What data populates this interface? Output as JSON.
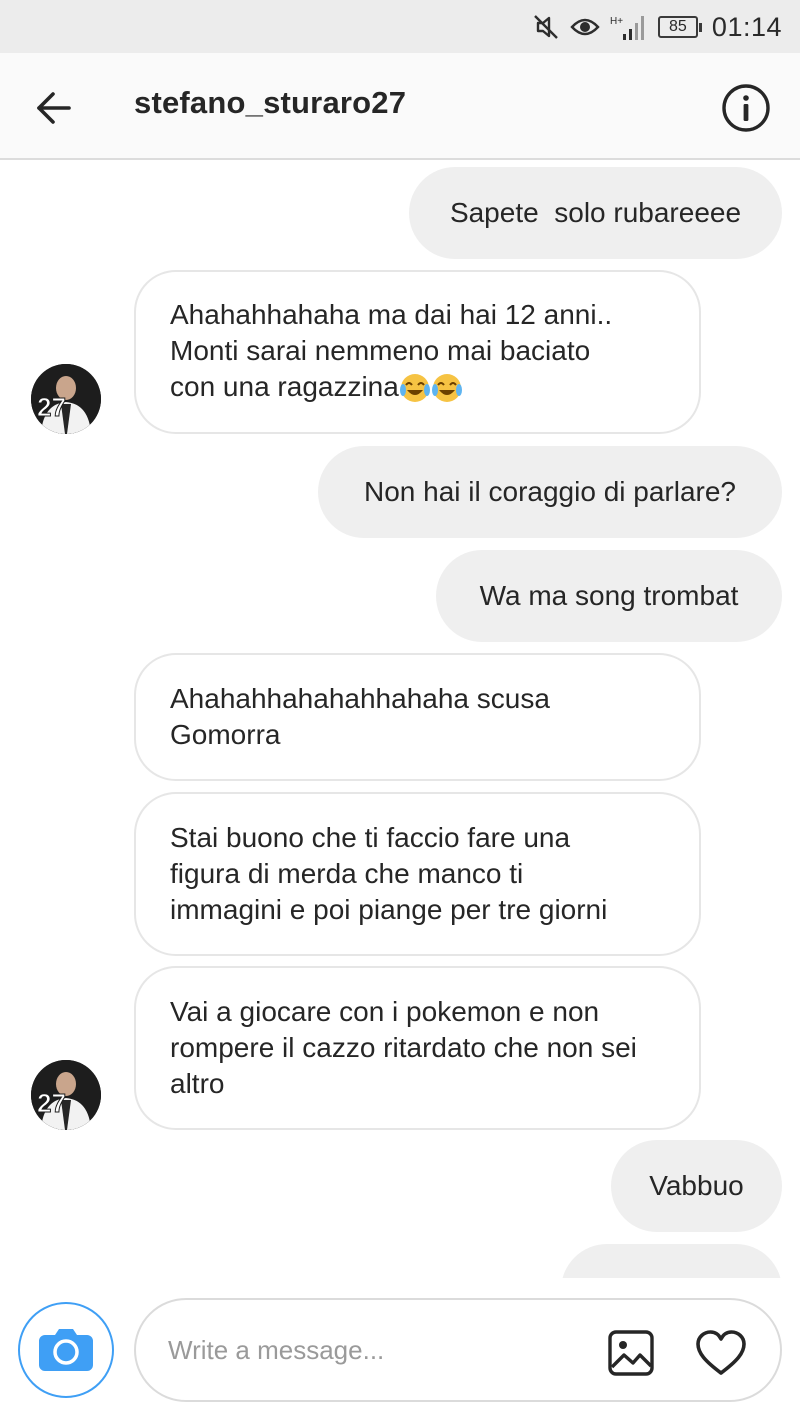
{
  "status_bar": {
    "icons": [
      "mute-icon",
      "eye-icon",
      "signal-icon"
    ],
    "network_label": "H+",
    "battery": "85",
    "time": "01:14"
  },
  "header": {
    "back_icon": "arrow-left-icon",
    "title": "stefano_sturaro27",
    "info_icon": "info-icon"
  },
  "messages": [
    {
      "side": "out",
      "text": "Sapete  solo rubareeee"
    },
    {
      "side": "in",
      "text": "Ahahahhahaha ma dai hai 12 anni..\nMonti sarai nemmeno mai baciato\ncon una ragazzina",
      "emoji": "tears-of-joy x2"
    },
    {
      "side": "out",
      "text": "Non hai il coraggio di parlare?"
    },
    {
      "side": "out",
      "text": "Wa ma song trombat"
    },
    {
      "side": "in",
      "text": "Ahahahhahahahhahaha scusa\nGomorra"
    },
    {
      "side": "in",
      "text": "Stai buono che ti faccio fare una\nfigura di merda che manco ti\nimmagini e poi piange per tre giorni"
    },
    {
      "side": "in",
      "text": "Vai a giocare con i pokemon e non\nrompere il cazzo ritardato che non sei\naltro"
    },
    {
      "side": "out",
      "text": "Vabbuo"
    }
  ],
  "composer": {
    "camera_icon": "camera-icon",
    "placeholder": "Write a message...",
    "value": "",
    "gallery_icon": "gallery-icon",
    "heart_icon": "heart-icon"
  },
  "colors": {
    "outgoing_bubble": "#efefef",
    "incoming_border": "#e6e6e6",
    "camera_accent": "#3f9ff5"
  }
}
